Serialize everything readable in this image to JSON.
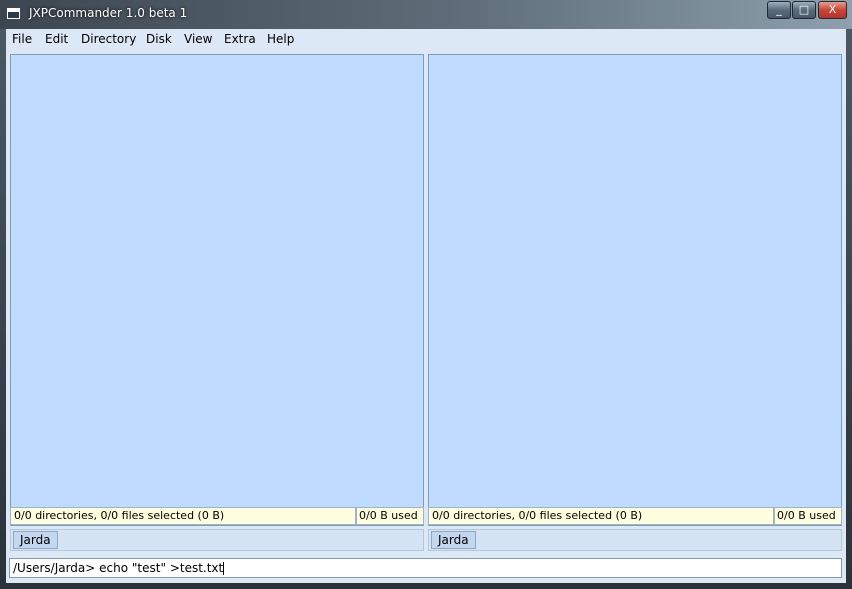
{
  "window": {
    "title": "JXPCommander 1.0 beta 1",
    "controls": {
      "minimize": "_",
      "maximize": "□",
      "close": "X"
    }
  },
  "menu": [
    "File",
    "Edit",
    "Directory",
    "Disk",
    "View",
    "Extra",
    "Help"
  ],
  "left_panel": {
    "status_selected": "0/0 directories, 0/0 files selected (0 B)",
    "status_used": "0/0 B used",
    "drive": "Jarda"
  },
  "right_panel": {
    "status_selected": "0/0 directories, 0/0 files selected (0 B)",
    "status_used": "0/0 B used",
    "drive": "Jarda"
  },
  "command_line": {
    "prompt": "/Users/Jarda>",
    "value": "echo \"test\" >test.txt"
  },
  "colors": {
    "panel_bg": "#bfdbff",
    "status_bg": "#ffffe0",
    "window_bg": "#dce8f6"
  }
}
